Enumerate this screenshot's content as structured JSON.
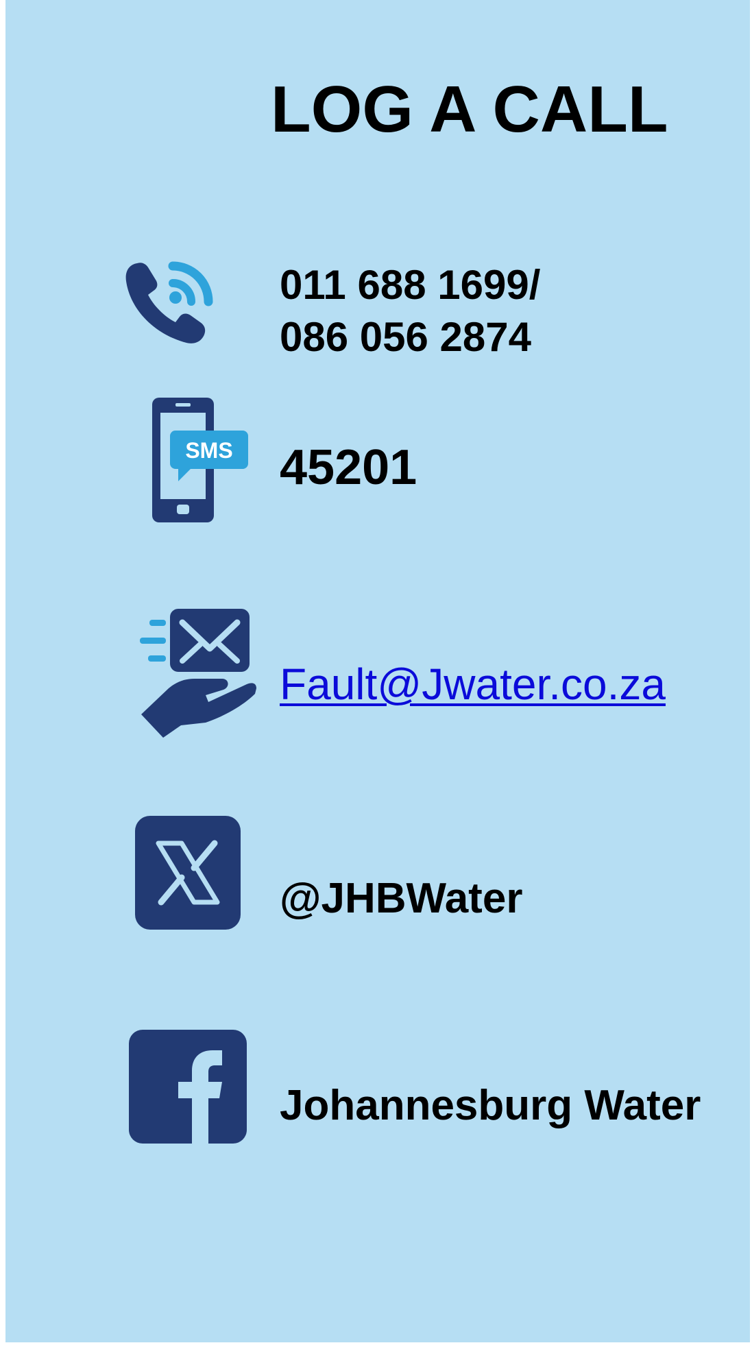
{
  "title": "LOG A CALL",
  "contacts": {
    "phone": {
      "icon": "phone-call-icon",
      "line1": "011 688 1699/",
      "line2": "086 056 2874"
    },
    "sms": {
      "icon": "mobile-sms-icon",
      "icon_label": "SMS",
      "number": "45201"
    },
    "email": {
      "icon": "email-hand-icon",
      "address": "Fault@Jwater.co.za"
    },
    "x": {
      "icon": "x-logo-icon",
      "handle": "@JHBWater"
    },
    "facebook": {
      "icon": "facebook-logo-icon",
      "name": "Johannesburg Water"
    }
  },
  "colors": {
    "background": "#b6def3",
    "icon_navy": "#223a73",
    "icon_accent": "#2ea3db",
    "link": "#0b0bd9",
    "text": "#000000"
  }
}
